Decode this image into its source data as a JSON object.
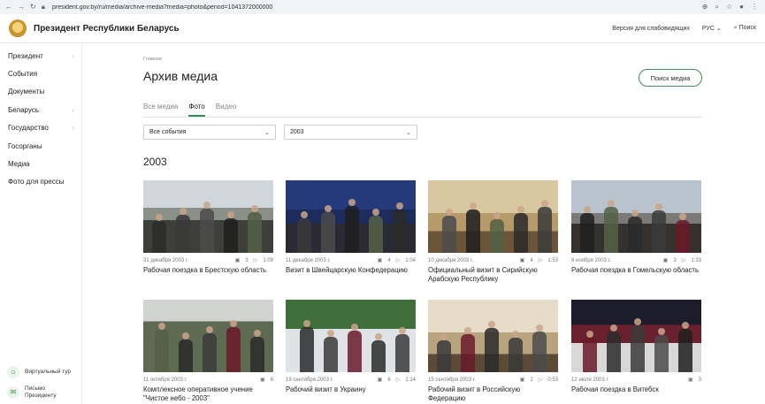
{
  "browser": {
    "url": "president.gov.by/ru/media/archive-media?media=photo&period=1041372000000"
  },
  "header": {
    "site_title": "Президент Республики Беларусь",
    "accessibility": "Версия для слабовидящих",
    "lang": "РУС",
    "search": "Поиск"
  },
  "sidebar": {
    "items": [
      {
        "label": "Президент",
        "has_children": true
      },
      {
        "label": "События",
        "has_children": false
      },
      {
        "label": "Документы",
        "has_children": false
      },
      {
        "label": "Беларусь",
        "has_children": true
      },
      {
        "label": "Государство",
        "has_children": true
      },
      {
        "label": "Госорганы",
        "has_children": false
      },
      {
        "label": "Медиа",
        "has_children": false
      },
      {
        "label": "Фото для прессы",
        "has_children": false
      }
    ],
    "virtual_tour": "Виртуальный тур",
    "letter": "Письмо Президенту"
  },
  "main": {
    "breadcrumb": "Главная",
    "title": "Архив медиа",
    "search_button": "Поиск медиа",
    "tabs": [
      {
        "label": "Все медиа",
        "active": false
      },
      {
        "label": "Фото",
        "active": true
      },
      {
        "label": "Видео",
        "active": false
      }
    ],
    "event_select": "Все события",
    "year_select": "2003",
    "year_heading": "2003",
    "cards": [
      {
        "date": "31 декабря 2003 г.",
        "photos": "3",
        "video": "1:09",
        "title": "Рабочая поездка в Брестскую область"
      },
      {
        "date": "11 декабря 2003 г.",
        "photos": "4",
        "video": "1:04",
        "title": "Визит в Швейцарскую Конфедерацию"
      },
      {
        "date": "10 декабря 2003 г.",
        "photos": "4",
        "video": "1:53",
        "title": "Официальный визит в Сирийскую Арабскую Республику"
      },
      {
        "date": "8 ноября 2003 г.",
        "photos": "3",
        "video": "1:33",
        "title": "Рабочая поездка в Гомельскую область"
      },
      {
        "date": "11 октября 2003 г.",
        "photos": "6",
        "video": "",
        "title": "Комплексное оперативное учение \"Чистое небо - 2003\""
      },
      {
        "date": "19 сентября 2003 г.",
        "photos": "6",
        "video": "1:14",
        "title": "Рабочий визит в Украину"
      },
      {
        "date": "15 сентября 2003 г.",
        "photos": "2",
        "video": "0:53",
        "title": "Рабочий визит в Российскую Федерацию"
      },
      {
        "date": "12 июля 2003 г.",
        "photos": "3",
        "video": "",
        "title": "Рабочая поездка в Витебск"
      }
    ]
  },
  "colors": {
    "accent": "#3a8a55",
    "text": "#222222",
    "muted": "#888888"
  }
}
